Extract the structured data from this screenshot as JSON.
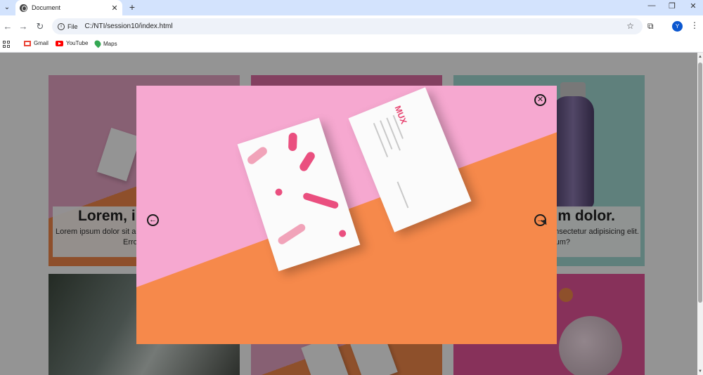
{
  "browser": {
    "tab_title": "Document",
    "new_tab_symbol": "+",
    "tab_close_symbol": "✕",
    "address_chip": "File",
    "url": "C:/NTI/session10/index.html",
    "avatar_letter": "Y",
    "bookmarks": [
      "Gmail",
      "YouTube",
      "Maps"
    ]
  },
  "cards": [
    {
      "title": "Lorem, ip",
      "text": "Lorem ipsum dolor sit am",
      "text2": "Erro"
    },
    {
      "title": "um dolor.",
      "text": "ensectetur adipisicing elit.",
      "text2": "um?"
    }
  ],
  "lightbox": {
    "card_brand": "MUX",
    "close_symbol": "✕",
    "prev_symbol": "←",
    "next_symbol": "→"
  }
}
